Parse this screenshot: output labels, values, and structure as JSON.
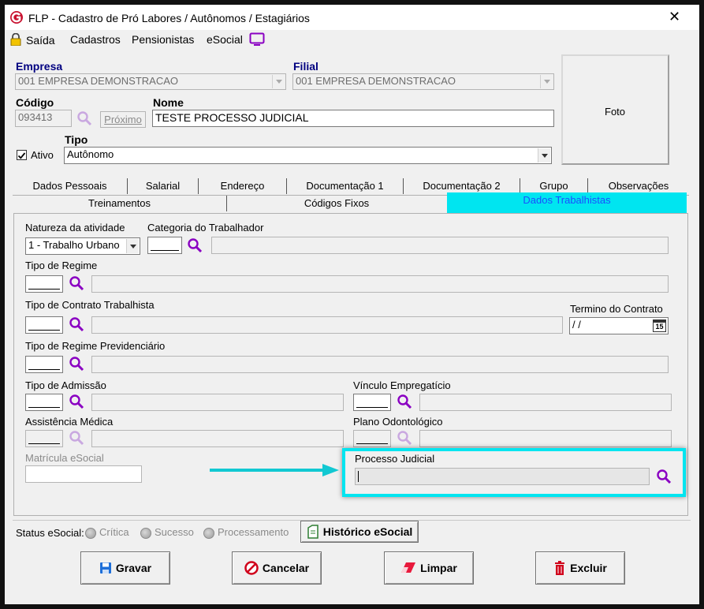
{
  "window": {
    "title": "FLP - Cadastro de Pró Labores / Autônomos / Estagiários",
    "close_glyph": "✕"
  },
  "menu": {
    "saida": "Saída",
    "cadastros": "Cadastros",
    "pensionistas": "Pensionistas",
    "esocial": "eSocial"
  },
  "header": {
    "empresa_label": "Empresa",
    "empresa_value": "001 EMPRESA DEMONSTRACAO",
    "filial_label": "Filial",
    "filial_value": "001 EMPRESA DEMONSTRACAO",
    "codigo_label": "Código",
    "codigo_value": "093413",
    "proximo_label": "Próximo",
    "nome_label": "Nome",
    "nome_value": "TESTE PROCESSO JUDICIAL",
    "tipo_label": "Tipo",
    "tipo_value": "Autônomo",
    "ativo_label": "Ativo",
    "ativo_checked": true,
    "foto_label": "Foto"
  },
  "tabs_row1": [
    "Dados Pessoais",
    "Salarial",
    "Endereço",
    "Documentação 1",
    "Documentação 2",
    "Grupo",
    "Observações"
  ],
  "tabs_row2": [
    "Treinamentos",
    "Códigos Fixos",
    "Dados Trabalhistas"
  ],
  "active_tab": "Dados Trabalhistas",
  "form": {
    "natureza_label": "Natureza da atividade",
    "natureza_value": "1 - Trabalho Urbano",
    "categoria_label": "Categoria do Trabalhador",
    "tipo_regime_label": "Tipo de Regime",
    "tipo_contrato_label": "Tipo de Contrato Trabalhista",
    "termino_label": "Termino do Contrato",
    "termino_value": " /  /",
    "calendar_day": "15",
    "regime_prev_label": "Tipo de Regime Previdenciário",
    "tipo_admissao_label": "Tipo de Admissão",
    "vinculo_label": "Vínculo Empregatício",
    "assistencia_label": "Assistência Médica",
    "plano_label": "Plano Odontológico",
    "matricula_label": "Matrícula eSocial",
    "processo_label": "Processo Judicial"
  },
  "status": {
    "label": "Status eSocial:",
    "options": [
      "Crítica",
      "Sucesso",
      "Processamento"
    ],
    "historico_label": "Histórico eSocial"
  },
  "buttons": {
    "gravar": "Gravar",
    "cancelar": "Cancelar",
    "limpar": "Limpar",
    "excluir": "Excluir"
  },
  "colors": {
    "highlight": "#00e5f0",
    "accent_purple": "#8a00c2",
    "label_blue": "#000080"
  }
}
